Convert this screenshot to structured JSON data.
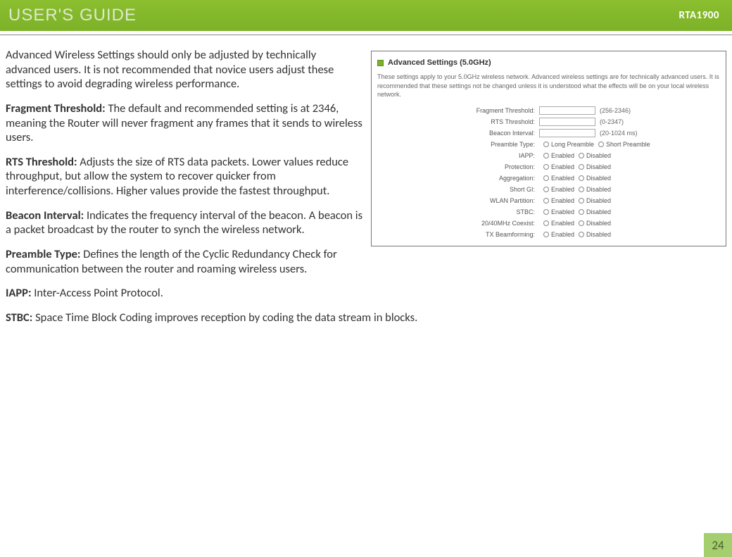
{
  "banner": {
    "title": "USER'S GUIDE",
    "model": "RTA1900"
  },
  "paragraphs": {
    "intro": "Advanced Wireless Settings should only be adjusted by technically advanced users. It is not recommended that novice users adjust these settings to avoid degrading wireless performance.",
    "frag_label": "Fragment Threshold: ",
    "frag_text": "The default and recommended setting is at 2346, meaning the Router will never fragment any frames that it sends to wireless users.",
    "rts_label": "RTS Threshold: ",
    "rts_text": "Adjusts the size of RTS data packets. Lower values reduce throughput, but allow the system to recover quicker from interference/collisions. Higher values provide the fastest throughput.",
    "beacon_label": "Beacon Interval: ",
    "beacon_text": "Indicates the frequency interval of the beacon. A beacon is a packet broadcast by the router to synch the wireless network.",
    "preamble_label": "Preamble Type: ",
    "preamble_text": "Defines the length of the Cyclic Redundancy Check for communication between the router and roaming wireless users.",
    "iapp_label": "IAPP: ",
    "iapp_text": "Inter-Access Point Protocol.",
    "stbc_label": "STBC: ",
    "stbc_text": "Space Time Block Coding improves reception by coding the data stream in blocks."
  },
  "figure": {
    "heading": "Advanced Settings (5.0GHz)",
    "desc": "These settings apply to your 5.0GHz wireless network. Advanced wireless settings are for technically advanced users. It is recommended that these settings not be changed unless it is understood what the effects will be on your local wireless network.",
    "rows": [
      {
        "label": "Fragment Threshold:",
        "type": "input",
        "hint": "(256-2346)"
      },
      {
        "label": "RTS Threshold:",
        "type": "input",
        "hint": "(0-2347)"
      },
      {
        "label": "Beacon Interval:",
        "type": "input",
        "hint": "(20-1024 ms)"
      },
      {
        "label": "Preamble Type:",
        "type": "radio",
        "opts": [
          "Long Preamble",
          "Short Preamble"
        ]
      },
      {
        "label": "IAPP:",
        "type": "radio",
        "opts": [
          "Enabled",
          "Disabled"
        ]
      },
      {
        "label": "Protection:",
        "type": "radio",
        "opts": [
          "Enabled",
          "Disabled"
        ]
      },
      {
        "label": "Aggregation:",
        "type": "radio",
        "opts": [
          "Enabled",
          "Disabled"
        ]
      },
      {
        "label": "Short GI:",
        "type": "radio",
        "opts": [
          "Enabled",
          "Disabled"
        ]
      },
      {
        "label": "WLAN Partition:",
        "type": "radio",
        "opts": [
          "Enabled",
          "Disabled"
        ]
      },
      {
        "label": "STBC:",
        "type": "radio",
        "opts": [
          "Enabled",
          "Disabled"
        ]
      },
      {
        "label": "20/40MHz Coexist:",
        "type": "radio",
        "opts": [
          "Enabled",
          "Disabled"
        ]
      },
      {
        "label": "TX Beamforming:",
        "type": "radio",
        "opts": [
          "Enabled",
          "Disabled"
        ]
      }
    ]
  },
  "page_number": "24"
}
